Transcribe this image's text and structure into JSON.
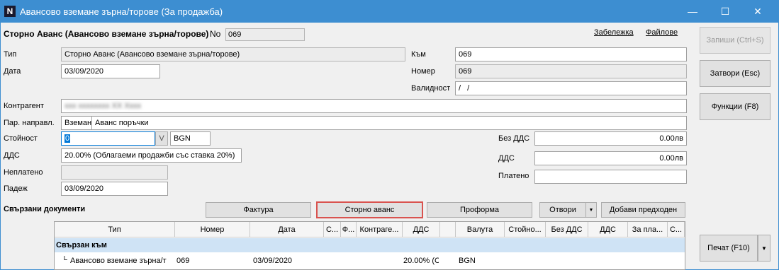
{
  "window": {
    "title": "Авансово вземане зърна/торове (За продажба)",
    "app_icon": "N",
    "minimize": "—",
    "maximize": "☐",
    "close": "✕"
  },
  "header": {
    "doc_title": "Сторно Аванс (Авансово вземане зърна/торове)",
    "no_label": "No",
    "no_value": "069",
    "note_link": "Забележка",
    "files_link": "Файлове"
  },
  "form": {
    "type_label": "Тип",
    "type_value": "Сторно Аванс (Авансово вземане зърна/торове)",
    "date_label": "Дата",
    "date_value": "03/09/2020",
    "to_label": "Към",
    "to_value": "069",
    "number_label": "Номер",
    "number_value": "069",
    "validity_label": "Валидност",
    "validity_value": "/ /",
    "contragent_label": "Контрагент",
    "contragent_value": "ххх хххххххх ХХ Хххх",
    "direction_label": "Пар. направл.",
    "direction_code": "Вземан",
    "direction_value": "Аванс поръчки",
    "value_label": "Стойност",
    "value_value": "0",
    "value_btn": "V",
    "currency": "BGN",
    "vat_label": "ДДС",
    "vat_value": "20.00% (Облагаеми продажби със ставка 20%)",
    "unpaid_label": "Неплатено",
    "unpaid_value": "",
    "due_label": "Падеж",
    "due_value": "03/09/2020",
    "no_vat_label": "Без ДДС",
    "no_vat_value": "0.00лв",
    "vat2_label": "ДДС",
    "vat2_value": "0.00лв",
    "paid_label": "Платено",
    "paid_value": ""
  },
  "side_buttons": {
    "save": "Запиши (Ctrl+S)",
    "close": "Затвори (Esc)",
    "functions": "Функции (F8)",
    "print": "Печат (F10)"
  },
  "related": {
    "title": "Свързани документи",
    "buttons": {
      "invoice": "Фактура",
      "storno": "Сторно аванс",
      "proforma": "Проформа",
      "open": "Отвори",
      "add_prev": "Добави предходен"
    },
    "columns": [
      "Тип",
      "Номер",
      "Дата",
      "С...",
      "Ф...",
      "Контраге...",
      "ДДС",
      "",
      "Валута",
      "Стойно...",
      "Без ДДС",
      "ДДС",
      "За пла...",
      "С..."
    ],
    "group_label": "Свързан към",
    "row": {
      "type": "Авансово вземане зърна/т",
      "number": "069",
      "date": "03/09/2020",
      "vat": "20.00% (С",
      "currency": "BGN"
    }
  }
}
